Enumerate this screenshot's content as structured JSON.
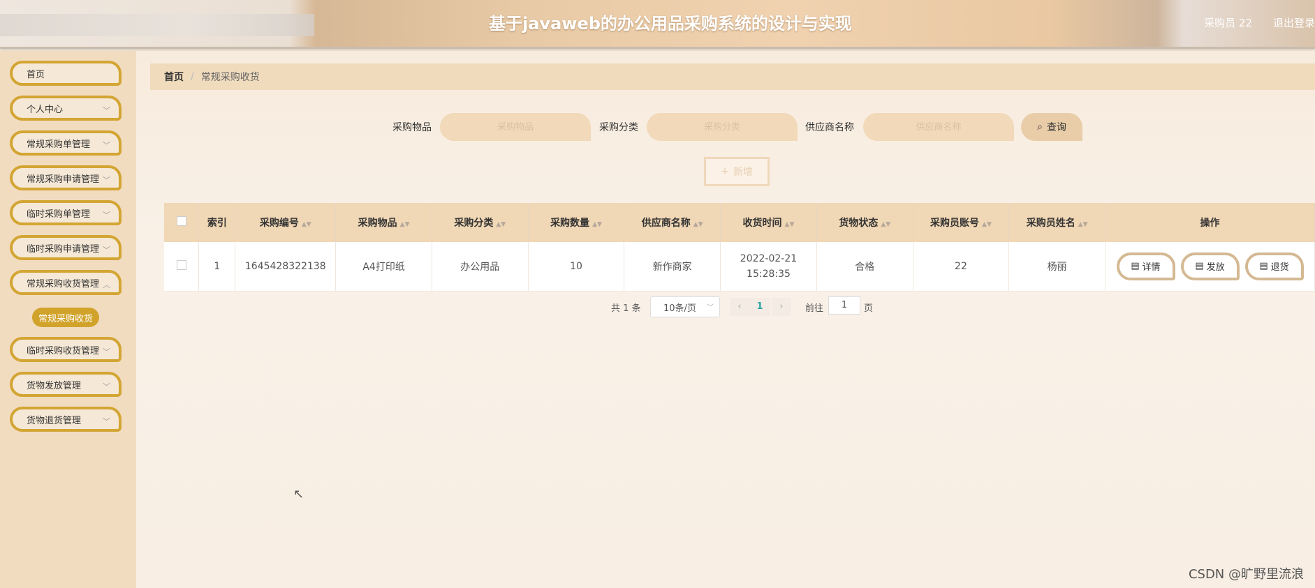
{
  "header": {
    "title": "基于javaweb的办公用品采购系统的设计与实现",
    "user": "采购员 22",
    "logout": "退出登录"
  },
  "sidebar": {
    "items": [
      {
        "label": "首页"
      },
      {
        "label": "个人中心"
      },
      {
        "label": "常规采购单管理"
      },
      {
        "label": "常规采购申请管理"
      },
      {
        "label": "临时采购单管理"
      },
      {
        "label": "临时采购申请管理"
      },
      {
        "label": "常规采购收货管理"
      },
      {
        "label": "临时采购收货管理"
      },
      {
        "label": "货物发放管理"
      },
      {
        "label": "货物退货管理"
      }
    ],
    "active_sub": "常规采购收货"
  },
  "breadcrumb": {
    "home": "首页",
    "separator": "/",
    "current": "常规采购收货"
  },
  "search": {
    "item_label": "采购物品",
    "item_placeholder": "采购物品",
    "category_label": "采购分类",
    "category_placeholder": "采购分类",
    "supplier_label": "供应商名称",
    "supplier_placeholder": "供应商名称",
    "query_button": "查询",
    "add_button": "新增"
  },
  "table": {
    "headers": [
      "索引",
      "采购编号",
      "采购物品",
      "采购分类",
      "采购数量",
      "供应商名称",
      "收货时间",
      "货物状态",
      "采购员账号",
      "采购员姓名",
      "操作"
    ],
    "rows": [
      {
        "index": "1",
        "number": "1645428322138",
        "item": "A4打印纸",
        "category": "办公用品",
        "quantity": "10",
        "supplier": "新作商家",
        "time": "2022-02-21 15:28:35",
        "status": "合格",
        "account": "22",
        "name": "杨丽"
      }
    ],
    "actions": [
      "详情",
      "发放",
      "退货"
    ]
  },
  "pagination": {
    "total": "共 1 条",
    "page_size": "10条/页",
    "current_page": "1",
    "goto_label": "前往",
    "goto_value": "1",
    "page_suffix": "页"
  },
  "watermark": "CSDN @旷野里流浪"
}
